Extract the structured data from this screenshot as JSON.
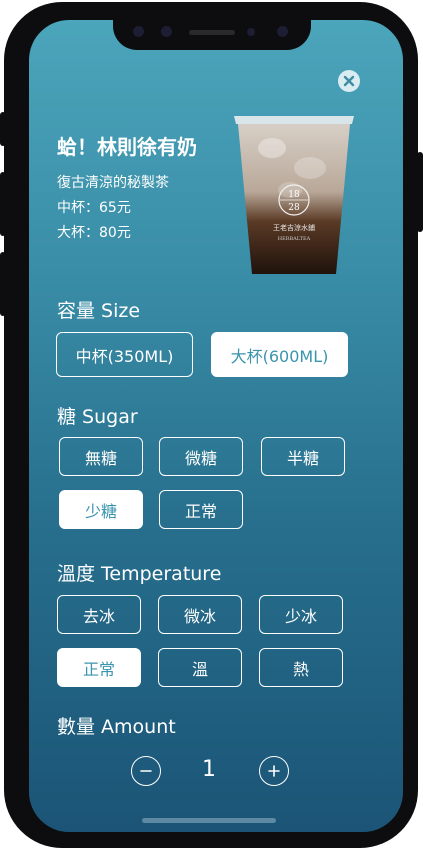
{
  "product": {
    "name": "蛤！林則徐有奶",
    "description": "復古清涼的秘製茶",
    "price_medium": "中杯：65元",
    "price_large": "大杯：80元",
    "cup_badge_top": "18",
    "cup_badge_bottom": "28",
    "cup_brand": "王老吉涼水鋪",
    "cup_brand_en": "HERBALTEA"
  },
  "size": {
    "label": "容量 Size",
    "options": [
      "中杯(350ML)",
      "大杯(600ML)"
    ],
    "selected": "大杯(600ML)"
  },
  "sugar": {
    "label": "糖 Sugar",
    "options": [
      "無糖",
      "微糖",
      "半糖",
      "少糖",
      "正常"
    ],
    "selected": "少糖"
  },
  "temperature": {
    "label": "溫度 Temperature",
    "options": [
      "去冰",
      "微冰",
      "少冰",
      "正常",
      "溫",
      "熱"
    ],
    "selected": "正常"
  },
  "amount": {
    "label": "數量 Amount",
    "value": "1"
  },
  "icons": {
    "close": "close-icon",
    "minus": "minus-icon",
    "plus": "plus-icon"
  },
  "colors": {
    "gradient_top": "#4ba5bb",
    "gradient_bottom": "#1b5476",
    "selected_text": "#3a94ad"
  }
}
